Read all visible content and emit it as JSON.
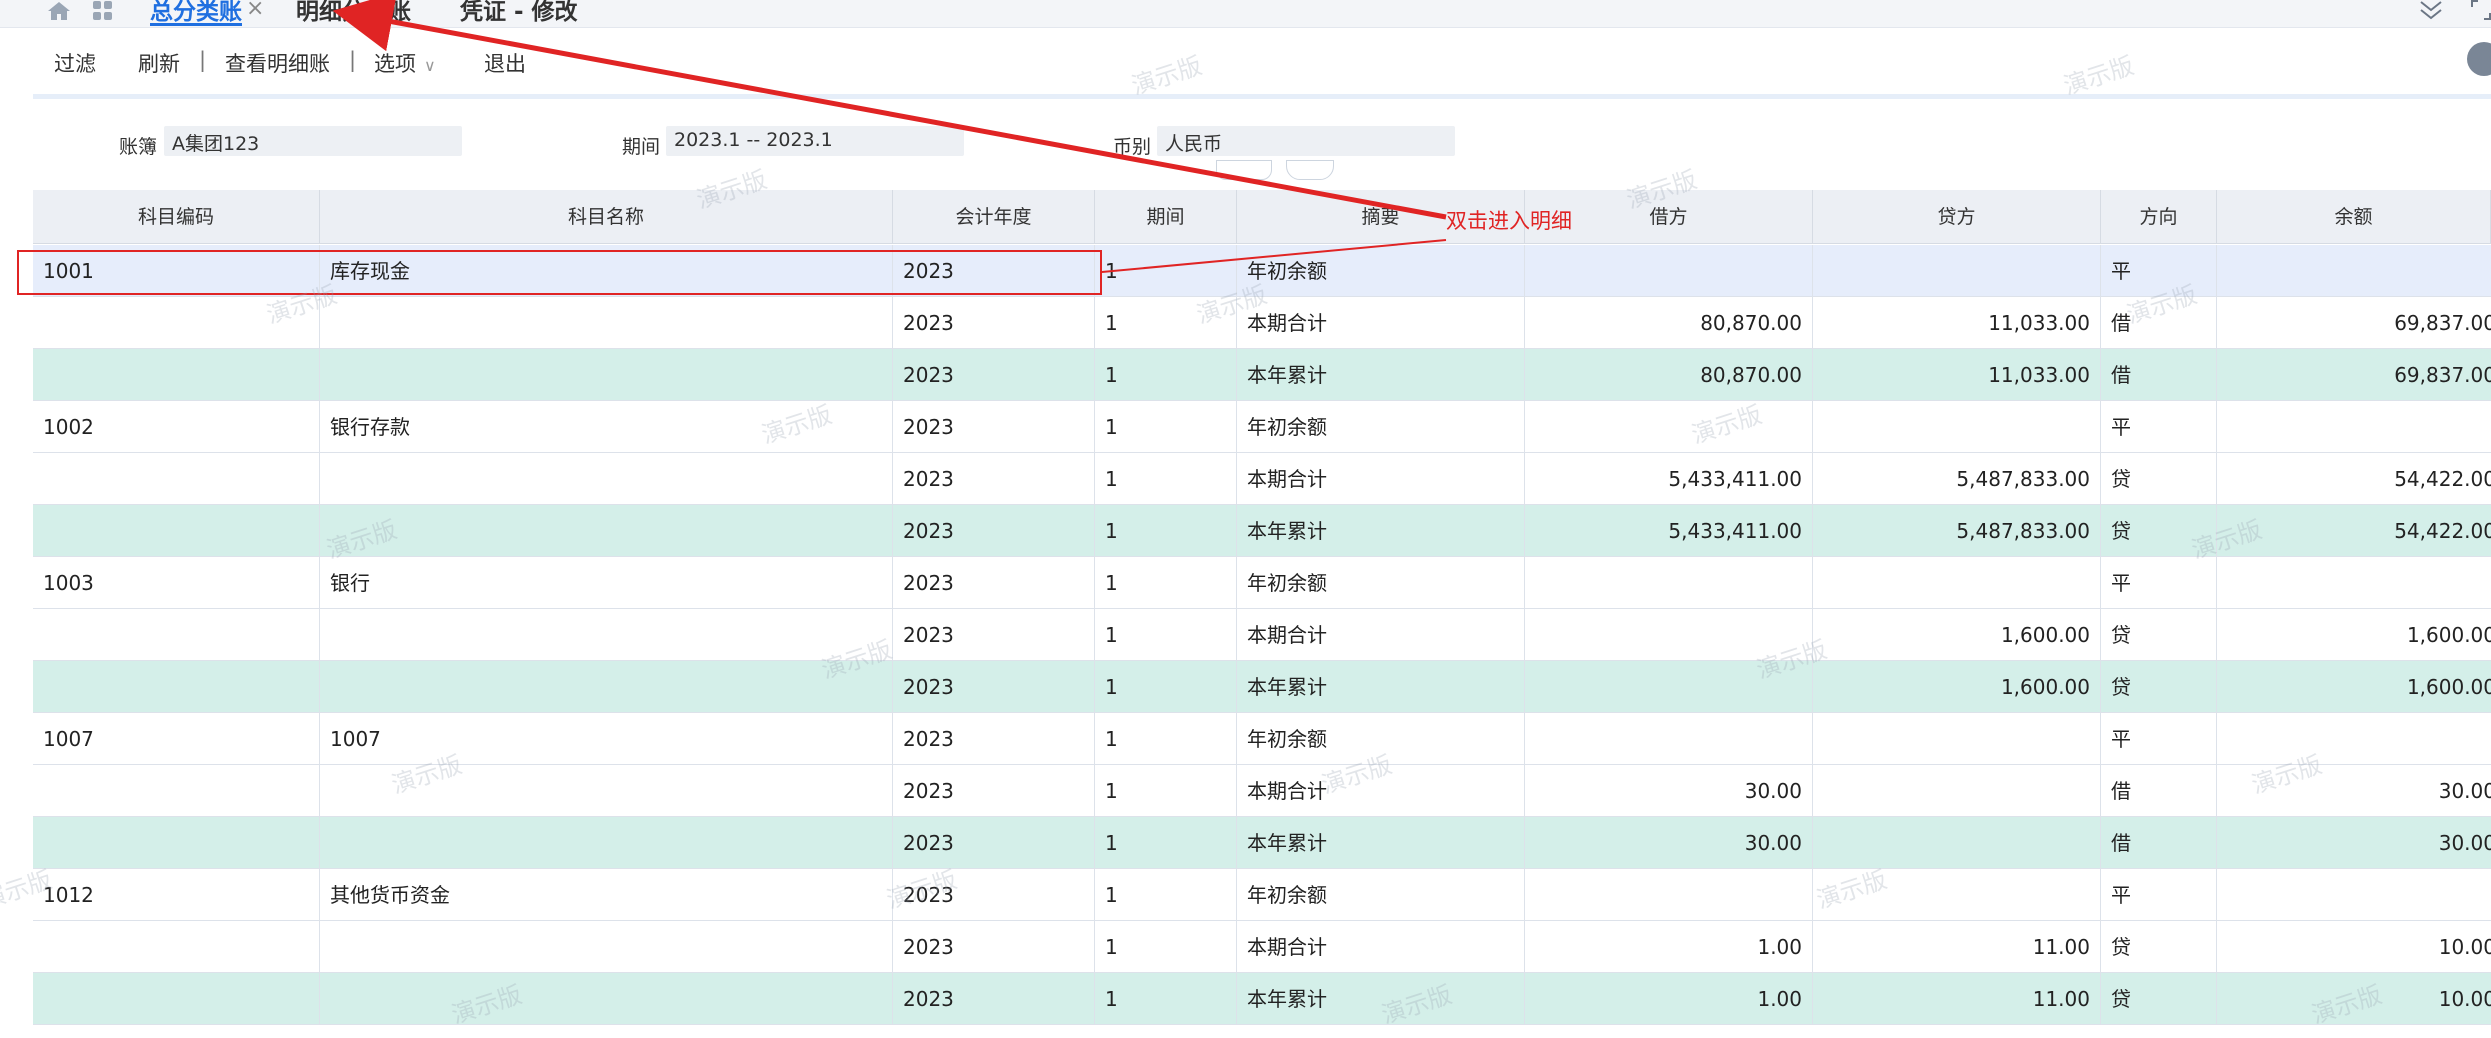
{
  "tabs": [
    {
      "label": "总分类账",
      "active": true,
      "closable": true
    },
    {
      "label": "明细分类账",
      "active": false
    },
    {
      "label": "凭证 - 修改",
      "active": false
    }
  ],
  "toolbar": {
    "items": [
      "过滤",
      "刷新",
      "查看明细账",
      "选项",
      "退出"
    ],
    "separator": "|"
  },
  "filters": {
    "ledger_label": "账簿",
    "ledger_value": "A集团123",
    "period_label": "期间",
    "period_value": "2023.1 -- 2023.1",
    "currency_label": "币别",
    "currency_value": "人民币"
  },
  "table": {
    "columns": [
      "科目编码",
      "科目名称",
      "会计年度",
      "期间",
      "摘要",
      "借方",
      "贷方",
      "方向",
      "余额"
    ],
    "rows": [
      {
        "code": "1001",
        "name": "库存现金",
        "year": "2023",
        "period": "1",
        "summary": "年初余额",
        "debit": "",
        "credit": "",
        "dir": "平",
        "balance": "",
        "type": "open"
      },
      {
        "code": "",
        "name": "",
        "year": "2023",
        "period": "1",
        "summary": "本期合计",
        "debit": "80,870.00",
        "credit": "11,033.00",
        "dir": "借",
        "balance": "69,837.00",
        "type": "period"
      },
      {
        "code": "",
        "name": "",
        "year": "2023",
        "period": "1",
        "summary": "本年累计",
        "debit": "80,870.00",
        "credit": "11,033.00",
        "dir": "借",
        "balance": "69,837.00",
        "type": "cum"
      },
      {
        "code": "1002",
        "name": "银行存款",
        "year": "2023",
        "period": "1",
        "summary": "年初余额",
        "debit": "",
        "credit": "",
        "dir": "平",
        "balance": "",
        "type": "open"
      },
      {
        "code": "",
        "name": "",
        "year": "2023",
        "period": "1",
        "summary": "本期合计",
        "debit": "5,433,411.00",
        "credit": "5,487,833.00",
        "dir": "贷",
        "balance": "54,422.00",
        "type": "period"
      },
      {
        "code": "",
        "name": "",
        "year": "2023",
        "period": "1",
        "summary": "本年累计",
        "debit": "5,433,411.00",
        "credit": "5,487,833.00",
        "dir": "贷",
        "balance": "54,422.00",
        "type": "cum"
      },
      {
        "code": "1003",
        "name": "银行",
        "year": "2023",
        "period": "1",
        "summary": "年初余额",
        "debit": "",
        "credit": "",
        "dir": "平",
        "balance": "",
        "type": "open"
      },
      {
        "code": "",
        "name": "",
        "year": "2023",
        "period": "1",
        "summary": "本期合计",
        "debit": "",
        "credit": "1,600.00",
        "dir": "贷",
        "balance": "1,600.00",
        "type": "period"
      },
      {
        "code": "",
        "name": "",
        "year": "2023",
        "period": "1",
        "summary": "本年累计",
        "debit": "",
        "credit": "1,600.00",
        "dir": "贷",
        "balance": "1,600.00",
        "type": "cum"
      },
      {
        "code": "1007",
        "name": "1007",
        "year": "2023",
        "period": "1",
        "summary": "年初余额",
        "debit": "",
        "credit": "",
        "dir": "平",
        "balance": "",
        "type": "open"
      },
      {
        "code": "",
        "name": "",
        "year": "2023",
        "period": "1",
        "summary": "本期合计",
        "debit": "30.00",
        "credit": "",
        "dir": "借",
        "balance": "30.00",
        "type": "period"
      },
      {
        "code": "",
        "name": "",
        "year": "2023",
        "period": "1",
        "summary": "本年累计",
        "debit": "30.00",
        "credit": "",
        "dir": "借",
        "balance": "30.00",
        "type": "cum"
      },
      {
        "code": "1012",
        "name": "其他货币资金",
        "year": "2023",
        "period": "1",
        "summary": "年初余额",
        "debit": "",
        "credit": "",
        "dir": "平",
        "balance": "",
        "type": "open"
      },
      {
        "code": "",
        "name": "",
        "year": "2023",
        "period": "1",
        "summary": "本期合计",
        "debit": "1.00",
        "credit": "11.00",
        "dir": "贷",
        "balance": "10.00",
        "type": "period"
      },
      {
        "code": "",
        "name": "",
        "year": "2023",
        "period": "1",
        "summary": "本年累计",
        "debit": "1.00",
        "credit": "11.00",
        "dir": "贷",
        "balance": "10.00",
        "type": "cum"
      }
    ]
  },
  "annotation": {
    "text": "双击进入明细"
  },
  "watermark": "演示版",
  "icons": {
    "home": "home-icon",
    "apps": "apps-grid-icon",
    "collapse": "double-chevron-down-icon",
    "fullscreen": "fullscreen-icon",
    "theme": "theme-toggle-icon"
  },
  "colors": {
    "active_tab": "#1f6fe0",
    "cumulative_row": "#d4efe9",
    "selected_row": "#e6edfb",
    "annotation": "#e02424"
  }
}
